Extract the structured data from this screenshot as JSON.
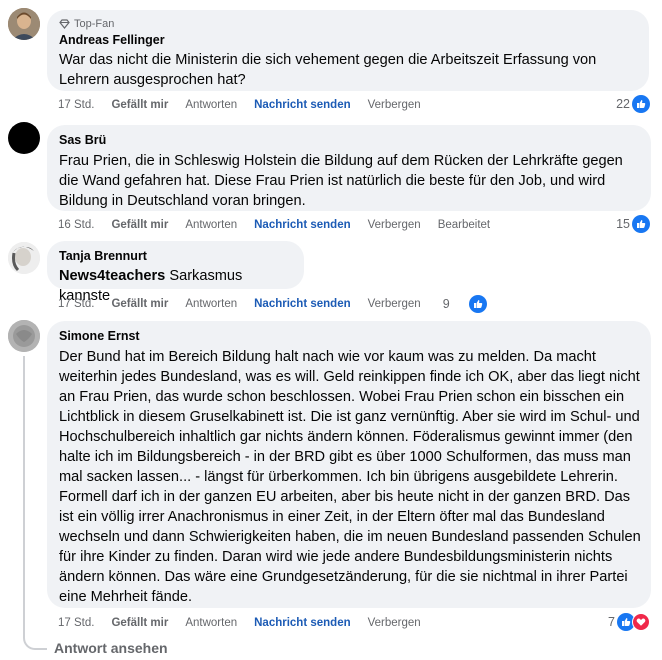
{
  "comments": [
    {
      "badge": "Top-Fan",
      "author": "Andreas Fellinger",
      "text": "War das nicht die Ministerin die sich vehement gegen die Arbeitszeit Erfassung von Lehrern ausgesprochen hat?",
      "time": "17 Std.",
      "like_label": "Gefällt mir",
      "reply_label": "Antworten",
      "message_label": "Nachricht senden",
      "hide_label": "Verbergen",
      "reaction_count": "22"
    },
    {
      "author": "Sas Brü",
      "text": "Frau Prien, die in Schleswig Holstein die Bildung auf dem Rücken der Lehrkräfte gegen die Wand gefahren hat. Diese Frau Prien ist natürlich die beste für den Job, und wird Bildung in Deutschland voran bringen.",
      "time": "16 Std.",
      "like_label": "Gefällt mir",
      "reply_label": "Antworten",
      "message_label": "Nachricht senden",
      "hide_label": "Verbergen",
      "edited_label": "Bearbeitet",
      "reaction_count": "15"
    },
    {
      "author": "Tanja Brennurt",
      "mention": "News4teachers",
      "text": "Sarkasmus kannste",
      "time": "17 Std.",
      "like_label": "Gefällt mir",
      "reply_label": "Antworten",
      "message_label": "Nachricht senden",
      "hide_label": "Verbergen",
      "reaction_count": "9"
    },
    {
      "author": "Simone Ernst",
      "text": "Der Bund hat im Bereich Bildung halt nach wie vor kaum was zu melden. Da macht weiterhin jedes Bundesland, was es will. Geld reinkippen finde ich OK, aber das liegt nicht an Frau Prien, das wurde schon beschlossen. Wobei Frau Prien schon ein bisschen ein Lichtblick in diesem Gruselkabinett ist. Die ist ganz vernünftig. Aber sie wird im Schul- und Hochschulbereich inhaltlich gar nichts ändern können. Föderalismus gewinnt immer (den halte ich im Bildungsbereich - in der BRD gibt es über 1000 Schulformen, das muss man mal sacken lassen... - längst für ürberkommen. Ich bin übrigens ausgebildete Lehrerin. Formell darf ich in der ganzen EU arbeiten, aber bis heute nicht in der ganzen BRD. Das ist ein völlig irrer Anachronismus in einer Zeit, in der Eltern öfter mal das Bundesland wechseln und dann Schwierigkeiten haben, die im neuen Bundesland passenden Schulen für ihre Kinder zu finden. Daran wird wie jede andere Bundesbildungsministerin nichts ändern können. Das wäre eine Grundgesetzänderung, für die sie nichtmal in ihrer Partei eine Mehrheit fände.",
      "time": "17 Std.",
      "like_label": "Gefällt mir",
      "reply_label": "Antworten",
      "message_label": "Nachricht senden",
      "hide_label": "Verbergen",
      "reaction_count": "7"
    }
  ],
  "view_replies_label": "Antwort ansehen",
  "colors": {
    "bubble": "#f0f2f5",
    "meta": "#65676b",
    "link": "#1c5bb5",
    "like": "#1877f2",
    "love": "#f0284a"
  }
}
